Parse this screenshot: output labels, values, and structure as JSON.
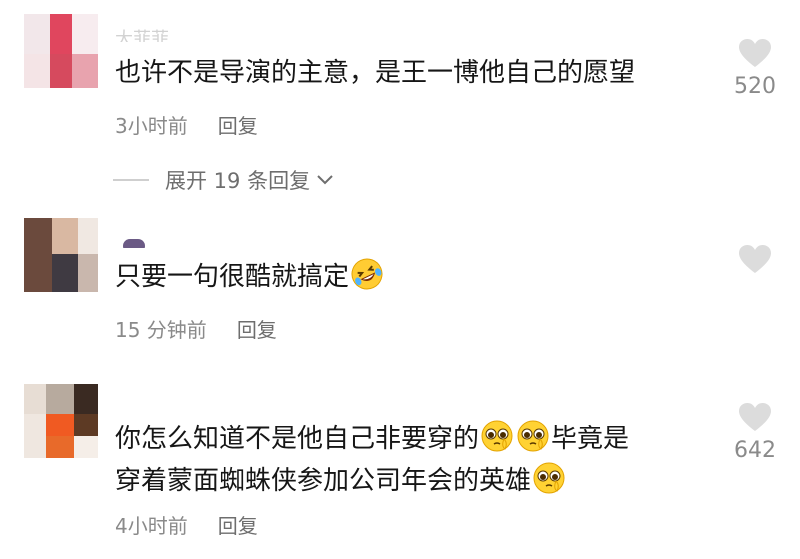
{
  "comments": [
    {
      "username": "大菲菲",
      "text": "也许不是导演的主意，是王一博他自己的愿望",
      "time": "3小时前",
      "reply": "回复",
      "likes": "520",
      "expand": "展开 19 条回复"
    },
    {
      "username": "",
      "text": "只要一句很酷就搞定",
      "emoji": "rolling-on-floor-laughing",
      "time": "15 分钟前",
      "reply": "回复",
      "likes": ""
    },
    {
      "username": "",
      "text_line1": "你怎么知道不是他自己非要穿的",
      "text_line1_end": "毕竟是",
      "text_line2": "穿着蒙面蜘蛛侠参加公司年会的英雄",
      "emoji": "pleading-face",
      "time": "4小时前",
      "reply": "回复",
      "likes": "642"
    }
  ],
  "icons": {
    "like": "heart-icon",
    "chevron": "chevron-down-icon"
  },
  "colors": {
    "heart": "#dcdcdc",
    "meta": "#8a8a8a",
    "text": "#161616"
  }
}
